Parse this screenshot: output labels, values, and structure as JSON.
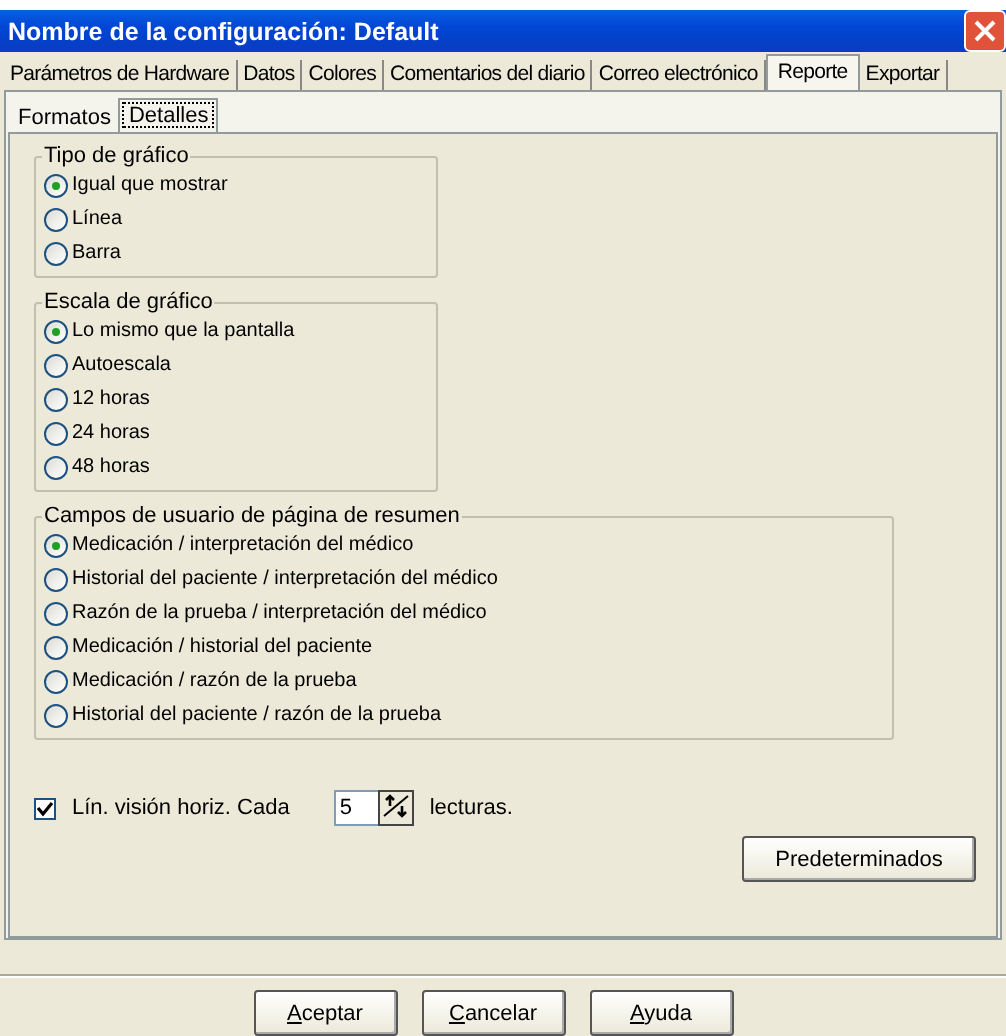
{
  "window": {
    "title": "Nombre de la configuración: Default"
  },
  "tabs": [
    {
      "label": "Parámetros de Hardware",
      "selected": false
    },
    {
      "label": "Datos",
      "selected": false
    },
    {
      "label": "Colores",
      "selected": false
    },
    {
      "label": "Comentarios del diario",
      "selected": false
    },
    {
      "label": "Correo electrónico",
      "selected": false
    },
    {
      "label": "Reporte",
      "selected": true
    },
    {
      "label": "Exportar",
      "selected": false
    }
  ],
  "subtabs": [
    {
      "label": "Formatos",
      "selected": false
    },
    {
      "label": "Detalles",
      "selected": true
    }
  ],
  "groups": [
    {
      "title": "Tipo de gráfico",
      "options": [
        {
          "label": "Igual que mostrar",
          "selected": true
        },
        {
          "label": "Línea",
          "selected": false
        },
        {
          "label": "Barra",
          "selected": false
        }
      ]
    },
    {
      "title": "Escala de gráfico",
      "options": [
        {
          "label": "Lo mismo que la pantalla",
          "selected": true
        },
        {
          "label": "Autoescala",
          "selected": false
        },
        {
          "label": "12 horas",
          "selected": false
        },
        {
          "label": "24 horas",
          "selected": false
        },
        {
          "label": "48 horas",
          "selected": false
        }
      ]
    },
    {
      "title": "Campos de usuario de página de resumen",
      "options": [
        {
          "label": "Medicación / interpretación del médico",
          "selected": true
        },
        {
          "label": "Historial del paciente / interpretación del médico",
          "selected": false
        },
        {
          "label": "Razón de la prueba / interpretación del médico",
          "selected": false
        },
        {
          "label": "Medicación / historial del paciente",
          "selected": false
        },
        {
          "label": "Medicación / razón de la prueba",
          "selected": false
        },
        {
          "label": "Historial del paciente / razón de la prueba",
          "selected": false
        }
      ]
    }
  ],
  "gridlines": {
    "label": "Lín. visión horiz. Cada",
    "checked": true,
    "value": "5",
    "suffix": "lecturas."
  },
  "defaults_button": "Predeterminados",
  "buttons": [
    "Aceptar",
    "Cancelar",
    "Ayuda"
  ]
}
